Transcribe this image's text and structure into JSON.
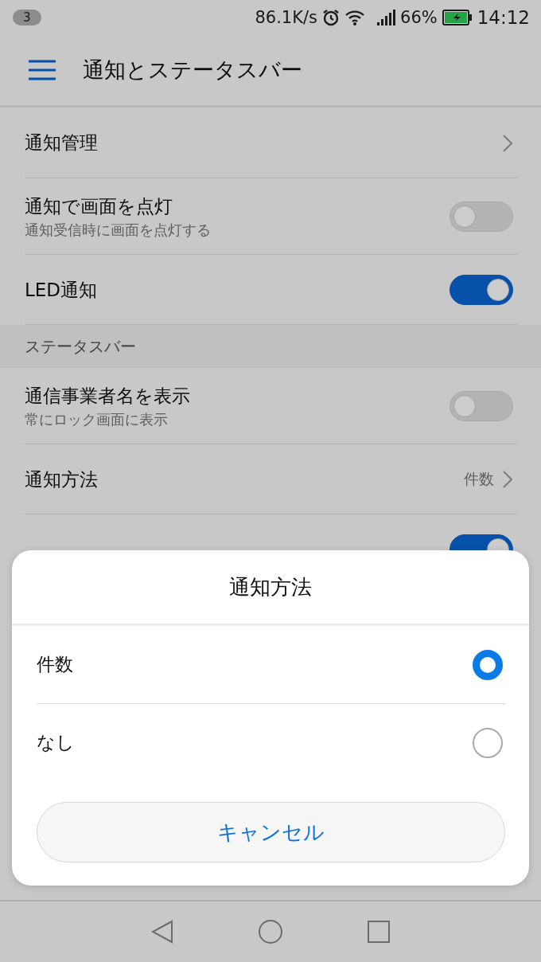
{
  "status_bar": {
    "badge": "3",
    "speed": "86.1K/s",
    "battery_percent": "66%",
    "time": "14:12"
  },
  "header": {
    "title": "通知とステータスバー"
  },
  "settings": [
    {
      "kind": "link",
      "label": "通知管理"
    },
    {
      "kind": "toggle",
      "label": "通知で画面を点灯",
      "description": "通知受信時に画面を点灯する",
      "on": false
    },
    {
      "kind": "toggle",
      "label": "LED通知",
      "on": true
    },
    {
      "kind": "section",
      "label": "ステータスバー"
    },
    {
      "kind": "toggle",
      "label": "通信事業者名を表示",
      "description": "常にロック画面に表示",
      "on": false
    },
    {
      "kind": "link",
      "label": "通知方法",
      "value": "件数"
    },
    {
      "kind": "toggle",
      "on": true
    }
  ],
  "dialog": {
    "title": "通知方法",
    "options": [
      {
        "label": "件数",
        "selected": true
      },
      {
        "label": "なし",
        "selected": false
      }
    ],
    "cancel": "キャンセル"
  }
}
